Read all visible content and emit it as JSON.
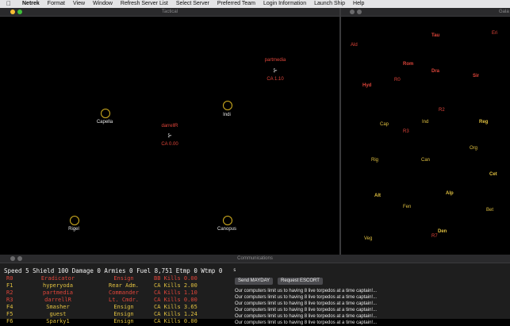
{
  "menubar": {
    "apple": "",
    "items": [
      "Netrek",
      "Format",
      "View",
      "Window",
      "Refresh Server List",
      "Select Server",
      "Preferred Team",
      "Login Information",
      "Launch Ship",
      "Help"
    ]
  },
  "tactical": {
    "title": "Tactical",
    "planets": [
      {
        "name": "Capella"
      },
      {
        "name": "Indi"
      },
      {
        "name": "Rigel"
      },
      {
        "name": "Canopus"
      }
    ],
    "ships": [
      {
        "name": "partmedia",
        "status": "CA 1.10",
        "glyph": "⊱"
      },
      {
        "name": "darrellR",
        "status": "CA 0.00",
        "glyph": "⊱"
      }
    ]
  },
  "galactic": {
    "title": "Gala",
    "labels": [
      {
        "text": "Eri",
        "style": "red"
      },
      {
        "text": "Ald",
        "style": "red"
      },
      {
        "text": "Tau",
        "style": "red b"
      },
      {
        "text": "Rom",
        "style": "red b"
      },
      {
        "text": "Dra",
        "style": "red b"
      },
      {
        "text": "Sir",
        "style": "red b"
      },
      {
        "text": "Hyd",
        "style": "red b"
      },
      {
        "text": "R0",
        "style": "red"
      },
      {
        "text": "R2",
        "style": "red"
      },
      {
        "text": "Cap",
        "style": "yel"
      },
      {
        "text": "Ind",
        "style": "yel"
      },
      {
        "text": "R3",
        "style": "red"
      },
      {
        "text": "Reg",
        "style": "yel b"
      },
      {
        "text": "Org",
        "style": "yel"
      },
      {
        "text": "Rig",
        "style": "yel"
      },
      {
        "text": "Can",
        "style": "yel"
      },
      {
        "text": "Cet",
        "style": "yel b"
      },
      {
        "text": "Alt",
        "style": "yel b"
      },
      {
        "text": "Alp",
        "style": "yel b"
      },
      {
        "text": "Fen",
        "style": "yel"
      },
      {
        "text": "Bet",
        "style": "yel"
      },
      {
        "text": "Den",
        "style": "yel b"
      },
      {
        "text": "R7",
        "style": "red"
      },
      {
        "text": "Veg",
        "style": "yel"
      }
    ]
  },
  "communications": {
    "title": "Communications",
    "status": "Speed 5 Shield 100 Damage 0 Armies 0 Fuel 8,751 Etmp 0 Wtmp 0",
    "input_value": "s",
    "mayday_label": "Send MAYDAY",
    "escort_label": "Request ESCORT",
    "players": [
      {
        "id": "R0",
        "name": "Eradicator",
        "rank": "Ensign",
        "kills": "BB Kills 0.00",
        "color": "#e0453a"
      },
      {
        "id": "F1",
        "name": "hyperyoda",
        "rank": "Rear Adm.",
        "kills": "CA Kills 2.00",
        "color": "#e0c040"
      },
      {
        "id": "R2",
        "name": "partmedia",
        "rank": "Commander",
        "kills": "CA Kills 1.10",
        "color": "#e0453a"
      },
      {
        "id": "R3",
        "name": "darrellR",
        "rank": "Lt. Cmdr.",
        "kills": "CA Kills 0.00",
        "color": "#e0453a"
      },
      {
        "id": "F4",
        "name": "Smasher",
        "rank": "Ensign",
        "kills": "CA Kills 3.65",
        "color": "#e0c040"
      },
      {
        "id": "F5",
        "name": "guest",
        "rank": "Ensign",
        "kills": "CA Kills 1.24",
        "color": "#e0c040"
      },
      {
        "id": "F6",
        "name": "Sparky1",
        "rank": "Ensign",
        "kills": "CA Kills 0.00",
        "color": "#e0c040"
      }
    ],
    "messages": [
      "Our computers limit us to having 8 live torpedos at a time captain!...",
      "Our computers limit us to having 8 live torpedos at a time captain!...",
      "Our computers limit us to having 8 live torpedos at a time captain!...",
      "Our computers limit us to having 8 live torpedos at a time captain!...",
      "Our computers limit us to having 8 live torpedos at a time captain!...",
      "Our computers limit us to having 8 live torpedos at a time captain!..."
    ]
  },
  "colors": {
    "federation": "#e0c040",
    "romulan": "#e0453a",
    "planet_ring": "#d4b020"
  }
}
